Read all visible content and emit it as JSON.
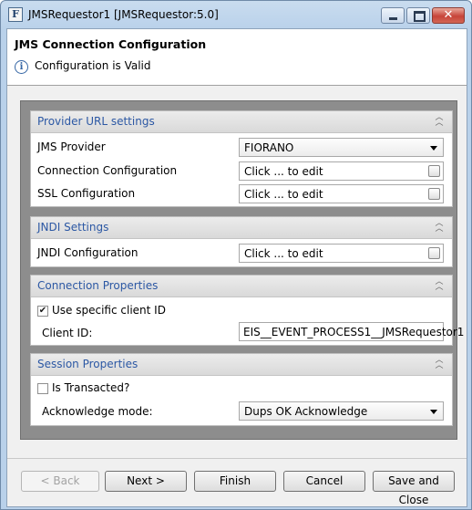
{
  "window": {
    "title": "JMSRequestor1 [JMSRequestor:5.0]",
    "app_icon_letter": "F"
  },
  "header": {
    "title": "JMS Connection Configuration",
    "status": "Configuration is Valid"
  },
  "sections": {
    "provider_url": {
      "title": "Provider URL settings",
      "jms_provider_label": "JMS Provider",
      "jms_provider_value": "FIORANO",
      "connection_config_label": "Connection Configuration",
      "connection_config_value": "Click ... to edit",
      "ssl_config_label": "SSL Configuration",
      "ssl_config_value": "Click ... to edit"
    },
    "jndi": {
      "title": "JNDI Settings",
      "jndi_config_label": "JNDI Configuration",
      "jndi_config_value": "Click ... to edit"
    },
    "connection_props": {
      "title": "Connection Properties",
      "use_client_id_label": "Use specific client ID",
      "use_client_id_checked": true,
      "client_id_label": "Client ID:",
      "client_id_value": "EIS__EVENT_PROCESS1__JMSRequestor1"
    },
    "session_props": {
      "title": "Session Properties",
      "is_transacted_label": "Is Transacted?",
      "is_transacted_checked": false,
      "ack_mode_label": "Acknowledge mode:",
      "ack_mode_value": "Dups OK Acknowledge"
    }
  },
  "buttons": {
    "back": "< Back",
    "next": "Next >",
    "finish": "Finish",
    "cancel": "Cancel",
    "save_close": "Save and Close"
  },
  "icons": {
    "info": "info-icon",
    "collapse": "double-chevron-up-icon",
    "dropdown": "dropdown-arrow-icon",
    "ellipsis": "ellipsis-edit-icon"
  }
}
